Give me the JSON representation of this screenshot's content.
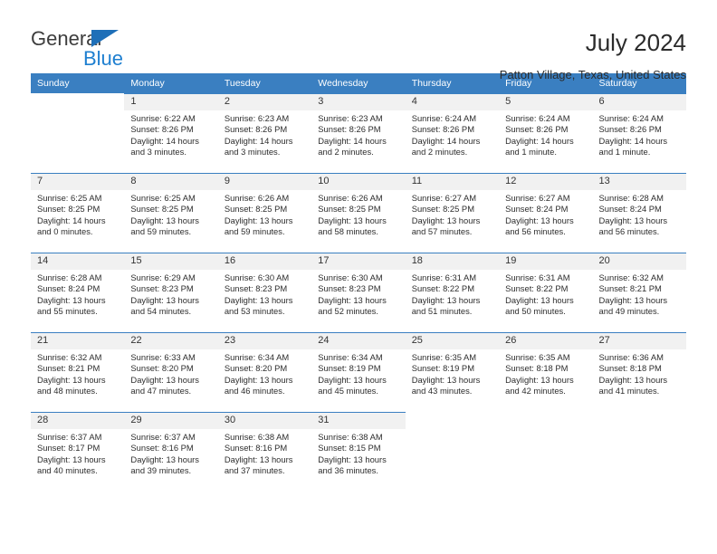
{
  "brand": {
    "name_top": "General",
    "name_bottom": "Blue",
    "triangle_color": "#1e6fb8",
    "blue_color": "#1e7fd0"
  },
  "header": {
    "title": "July 2024",
    "subtitle": "Patton Village, Texas, United States"
  },
  "colors": {
    "header_blue": "#3a7fc1",
    "daynum_bg": "#f1f1f1",
    "text": "#2d2d2d"
  },
  "weekday_headers": [
    "Sunday",
    "Monday",
    "Tuesday",
    "Wednesday",
    "Thursday",
    "Friday",
    "Saturday"
  ],
  "labels": {
    "sunrise_prefix": "Sunrise: ",
    "sunset_prefix": "Sunset: ",
    "daylight_prefix": "Daylight: "
  },
  "weeks": [
    [
      {
        "day": "",
        "sunrise": "",
        "sunset": "",
        "daylight": "",
        "blank": true
      },
      {
        "day": "1",
        "sunrise": "Sunrise: 6:22 AM",
        "sunset": "Sunset: 8:26 PM",
        "daylight": "Daylight: 14 hours and 3 minutes."
      },
      {
        "day": "2",
        "sunrise": "Sunrise: 6:23 AM",
        "sunset": "Sunset: 8:26 PM",
        "daylight": "Daylight: 14 hours and 3 minutes."
      },
      {
        "day": "3",
        "sunrise": "Sunrise: 6:23 AM",
        "sunset": "Sunset: 8:26 PM",
        "daylight": "Daylight: 14 hours and 2 minutes."
      },
      {
        "day": "4",
        "sunrise": "Sunrise: 6:24 AM",
        "sunset": "Sunset: 8:26 PM",
        "daylight": "Daylight: 14 hours and 2 minutes."
      },
      {
        "day": "5",
        "sunrise": "Sunrise: 6:24 AM",
        "sunset": "Sunset: 8:26 PM",
        "daylight": "Daylight: 14 hours and 1 minute."
      },
      {
        "day": "6",
        "sunrise": "Sunrise: 6:24 AM",
        "sunset": "Sunset: 8:26 PM",
        "daylight": "Daylight: 14 hours and 1 minute."
      }
    ],
    [
      {
        "day": "7",
        "sunrise": "Sunrise: 6:25 AM",
        "sunset": "Sunset: 8:25 PM",
        "daylight": "Daylight: 14 hours and 0 minutes."
      },
      {
        "day": "8",
        "sunrise": "Sunrise: 6:25 AM",
        "sunset": "Sunset: 8:25 PM",
        "daylight": "Daylight: 13 hours and 59 minutes."
      },
      {
        "day": "9",
        "sunrise": "Sunrise: 6:26 AM",
        "sunset": "Sunset: 8:25 PM",
        "daylight": "Daylight: 13 hours and 59 minutes."
      },
      {
        "day": "10",
        "sunrise": "Sunrise: 6:26 AM",
        "sunset": "Sunset: 8:25 PM",
        "daylight": "Daylight: 13 hours and 58 minutes."
      },
      {
        "day": "11",
        "sunrise": "Sunrise: 6:27 AM",
        "sunset": "Sunset: 8:25 PM",
        "daylight": "Daylight: 13 hours and 57 minutes."
      },
      {
        "day": "12",
        "sunrise": "Sunrise: 6:27 AM",
        "sunset": "Sunset: 8:24 PM",
        "daylight": "Daylight: 13 hours and 56 minutes."
      },
      {
        "day": "13",
        "sunrise": "Sunrise: 6:28 AM",
        "sunset": "Sunset: 8:24 PM",
        "daylight": "Daylight: 13 hours and 56 minutes."
      }
    ],
    [
      {
        "day": "14",
        "sunrise": "Sunrise: 6:28 AM",
        "sunset": "Sunset: 8:24 PM",
        "daylight": "Daylight: 13 hours and 55 minutes."
      },
      {
        "day": "15",
        "sunrise": "Sunrise: 6:29 AM",
        "sunset": "Sunset: 8:23 PM",
        "daylight": "Daylight: 13 hours and 54 minutes."
      },
      {
        "day": "16",
        "sunrise": "Sunrise: 6:30 AM",
        "sunset": "Sunset: 8:23 PM",
        "daylight": "Daylight: 13 hours and 53 minutes."
      },
      {
        "day": "17",
        "sunrise": "Sunrise: 6:30 AM",
        "sunset": "Sunset: 8:23 PM",
        "daylight": "Daylight: 13 hours and 52 minutes."
      },
      {
        "day": "18",
        "sunrise": "Sunrise: 6:31 AM",
        "sunset": "Sunset: 8:22 PM",
        "daylight": "Daylight: 13 hours and 51 minutes."
      },
      {
        "day": "19",
        "sunrise": "Sunrise: 6:31 AM",
        "sunset": "Sunset: 8:22 PM",
        "daylight": "Daylight: 13 hours and 50 minutes."
      },
      {
        "day": "20",
        "sunrise": "Sunrise: 6:32 AM",
        "sunset": "Sunset: 8:21 PM",
        "daylight": "Daylight: 13 hours and 49 minutes."
      }
    ],
    [
      {
        "day": "21",
        "sunrise": "Sunrise: 6:32 AM",
        "sunset": "Sunset: 8:21 PM",
        "daylight": "Daylight: 13 hours and 48 minutes."
      },
      {
        "day": "22",
        "sunrise": "Sunrise: 6:33 AM",
        "sunset": "Sunset: 8:20 PM",
        "daylight": "Daylight: 13 hours and 47 minutes."
      },
      {
        "day": "23",
        "sunrise": "Sunrise: 6:34 AM",
        "sunset": "Sunset: 8:20 PM",
        "daylight": "Daylight: 13 hours and 46 minutes."
      },
      {
        "day": "24",
        "sunrise": "Sunrise: 6:34 AM",
        "sunset": "Sunset: 8:19 PM",
        "daylight": "Daylight: 13 hours and 45 minutes."
      },
      {
        "day": "25",
        "sunrise": "Sunrise: 6:35 AM",
        "sunset": "Sunset: 8:19 PM",
        "daylight": "Daylight: 13 hours and 43 minutes."
      },
      {
        "day": "26",
        "sunrise": "Sunrise: 6:35 AM",
        "sunset": "Sunset: 8:18 PM",
        "daylight": "Daylight: 13 hours and 42 minutes."
      },
      {
        "day": "27",
        "sunrise": "Sunrise: 6:36 AM",
        "sunset": "Sunset: 8:18 PM",
        "daylight": "Daylight: 13 hours and 41 minutes."
      }
    ],
    [
      {
        "day": "28",
        "sunrise": "Sunrise: 6:37 AM",
        "sunset": "Sunset: 8:17 PM",
        "daylight": "Daylight: 13 hours and 40 minutes."
      },
      {
        "day": "29",
        "sunrise": "Sunrise: 6:37 AM",
        "sunset": "Sunset: 8:16 PM",
        "daylight": "Daylight: 13 hours and 39 minutes."
      },
      {
        "day": "30",
        "sunrise": "Sunrise: 6:38 AM",
        "sunset": "Sunset: 8:16 PM",
        "daylight": "Daylight: 13 hours and 37 minutes."
      },
      {
        "day": "31",
        "sunrise": "Sunrise: 6:38 AM",
        "sunset": "Sunset: 8:15 PM",
        "daylight": "Daylight: 13 hours and 36 minutes."
      },
      {
        "day": "",
        "sunrise": "",
        "sunset": "",
        "daylight": "",
        "blank": true
      },
      {
        "day": "",
        "sunrise": "",
        "sunset": "",
        "daylight": "",
        "blank": true
      },
      {
        "day": "",
        "sunrise": "",
        "sunset": "",
        "daylight": "",
        "blank": true
      }
    ]
  ]
}
